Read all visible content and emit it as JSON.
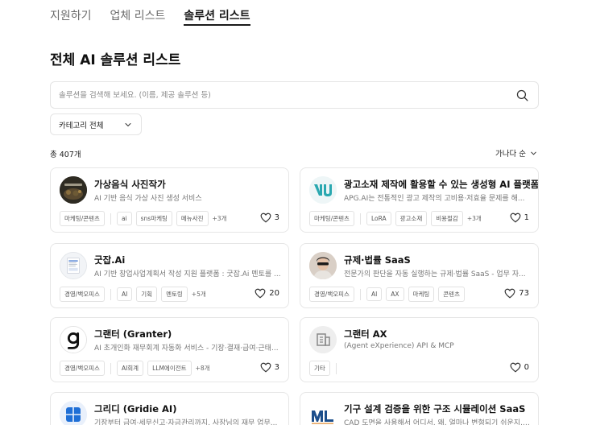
{
  "tabs": [
    {
      "label": "지원하기",
      "active": false
    },
    {
      "label": "업체 리스트",
      "active": false
    },
    {
      "label": "솔루션 리스트",
      "active": true
    }
  ],
  "page_title": "전체 AI 솔루션 리스트",
  "search": {
    "placeholder": "솔루션을 검색해 보세요. (이름, 제공 솔루션 등)",
    "value": ""
  },
  "category_select": {
    "selected": "카테고리 전체"
  },
  "total_count": "총 407개",
  "sort": {
    "selected": "가나다 순"
  },
  "cards": [
    {
      "name": "가상음식 사진작가",
      "desc": "AI 기반 음식 가상 사진 생성 서비스",
      "tags": [
        "마케팅/콘텐츠",
        "ai",
        "sns마케팅",
        "메뉴사진"
      ],
      "more": "+3개",
      "likes": "3",
      "logo": "dark-photo"
    },
    {
      "name": "광고소재 제작에 활용할 수 있는 생성형 AI 플랫폼",
      "desc": "APG.AI는 전통적인 광고 제작의 고비용·저효율 문제를 해...",
      "tags": [
        "마케팅/콘텐츠",
        "LoRA",
        "광고소재",
        "비용절감"
      ],
      "more": "+3개",
      "likes": "1",
      "logo": "vu-logo"
    },
    {
      "name": "굿잡.Ai",
      "desc": "AI 기반 창업사업계획서 작성 지원 플랫폼 : 굿잡.Ai 멘토를 ...",
      "tags": [
        "경영/백오피스",
        "AI",
        "기획",
        "멘토링"
      ],
      "more": "+5개",
      "likes": "20",
      "logo": "doc-thumb"
    },
    {
      "name": "규제·법률 SaaS",
      "desc": "전문가의 판단을 자동 실행하는 규제·법률 SaaS - 업무 자...",
      "tags": [
        "경영/백오피스",
        "AI",
        "AX",
        "마케팅",
        "콘텐츠"
      ],
      "more": "",
      "likes": "73",
      "logo": "person-photo"
    },
    {
      "name": "그랜터 (Granter)",
      "desc": "AI 초개인화 재무회계 자동화 서비스 - 기장·결재·급여·근태...",
      "tags": [
        "경영/백오피스",
        "AI회계",
        "LLM에이전트"
      ],
      "more": "+8개",
      "likes": "3",
      "logo": "g-logo"
    },
    {
      "name": "그랜터 AX",
      "desc": "(Agent eXperience) API & MCP",
      "tags": [
        "기타"
      ],
      "more": "",
      "likes": "0",
      "logo": "building-icon"
    },
    {
      "name": "그리디 (Gridie AI)",
      "desc": "기장부터 급여·세무신고·자금관리까지, 사장님의 재무 업무...",
      "tags": [],
      "more": "",
      "likes": "",
      "logo": "blue-grid"
    },
    {
      "name": "기구 설계 검증을 위한 구조 시뮬레이션 SaaS",
      "desc": "CAD 도면을 사용해서 어디서, 왜, 얼마나 변형되기 쉬운지, ...",
      "tags": [],
      "more": "",
      "likes": "",
      "logo": "ml-logo"
    }
  ],
  "colors": {
    "accent": "#1a1a1a",
    "border": "#e6e6e6",
    "muted": "#777777",
    "vu_teal": "#2aa8b0",
    "gridie_blue": "#1f6fd6"
  }
}
